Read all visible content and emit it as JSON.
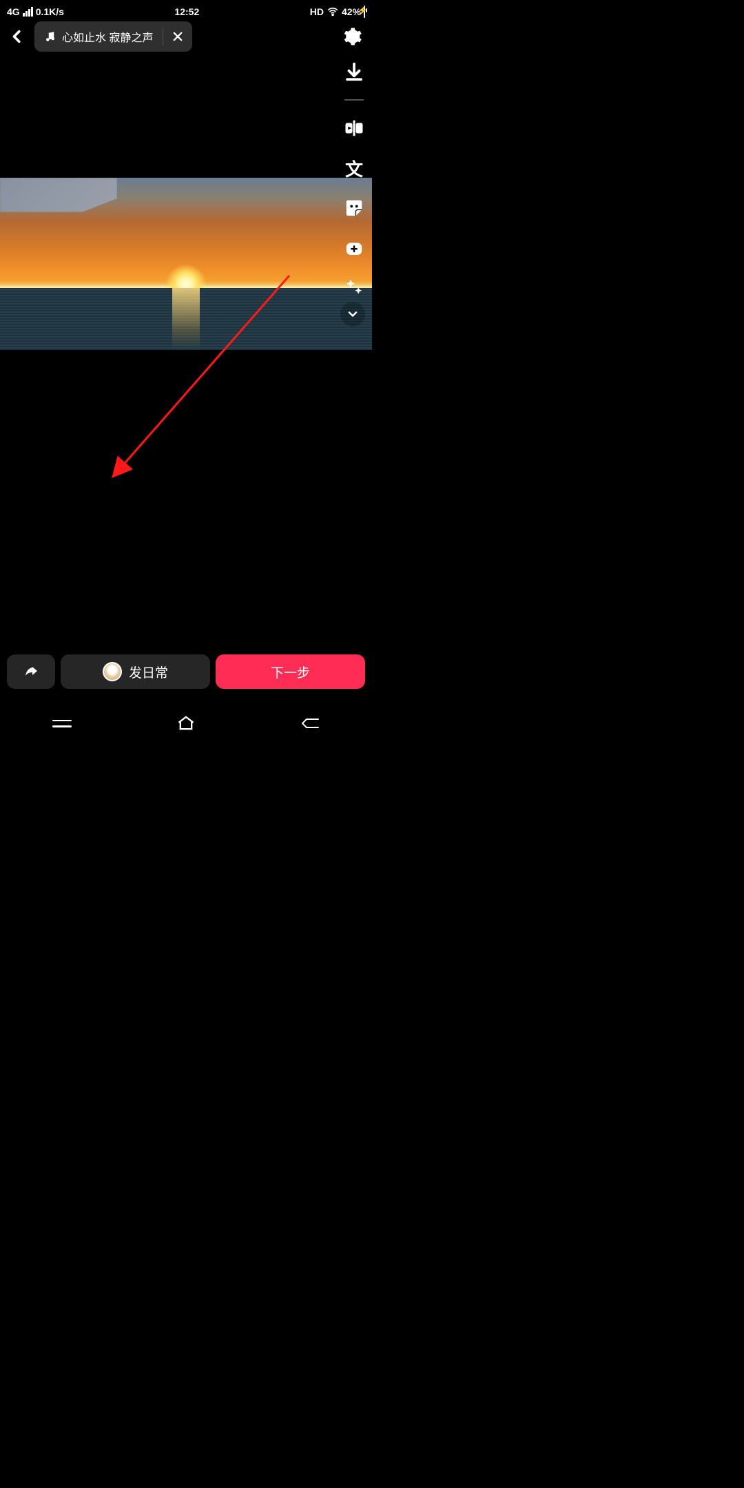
{
  "status": {
    "network": "4G",
    "speed": "0.1K/s",
    "time": "12:52",
    "hd": "HD",
    "battery_pct": "42%"
  },
  "topbar": {
    "music_title": "心如止水 寂静之声"
  },
  "tools": {
    "text_icon": "文"
  },
  "bottom": {
    "daily_label": "发日常",
    "next_label": "下一步"
  }
}
